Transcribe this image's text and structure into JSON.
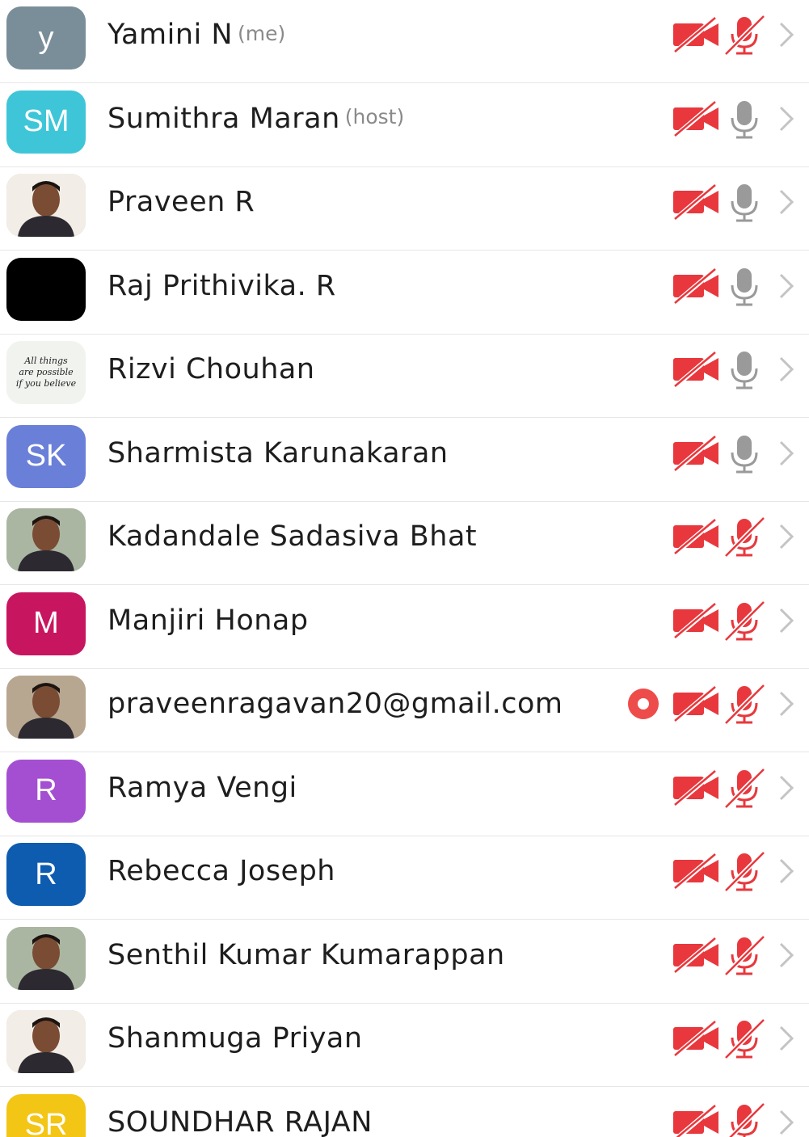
{
  "participants": [
    {
      "name": "Yamini N",
      "tag": "(me)",
      "avatar_type": "initials",
      "initials": "y",
      "avatar_color": "#7a8e9a",
      "video": "off",
      "audio": "muted",
      "recording": false
    },
    {
      "name": "Sumithra Maran",
      "tag": "(host)",
      "avatar_type": "initials",
      "initials": "SM",
      "avatar_color": "#3ec6d8",
      "video": "off",
      "audio": "unmuted",
      "recording": false
    },
    {
      "name": "Praveen R",
      "tag": "",
      "avatar_type": "photo",
      "photo_icon": "person-photo",
      "video": "off",
      "audio": "unmuted",
      "recording": false
    },
    {
      "name": "Raj Prithivika. R",
      "tag": "",
      "avatar_type": "black",
      "avatar_color": "#000000",
      "video": "off",
      "audio": "unmuted",
      "recording": false
    },
    {
      "name": "Rizvi Chouhan",
      "tag": "",
      "avatar_type": "text-photo",
      "photo_text": [
        "All things",
        "are possible",
        "if you believe"
      ],
      "video": "off",
      "audio": "unmuted",
      "recording": false
    },
    {
      "name": "Sharmista Karunakaran",
      "tag": "",
      "avatar_type": "initials",
      "initials": "SK",
      "avatar_color": "#6a7fd8",
      "video": "off",
      "audio": "unmuted",
      "recording": false
    },
    {
      "name": "Kadandale Sadasiva Bhat",
      "tag": "",
      "avatar_type": "photo",
      "photo_icon": "person-photo",
      "video": "off",
      "audio": "muted",
      "recording": false
    },
    {
      "name": "Manjiri Honap",
      "tag": "",
      "avatar_type": "initials",
      "initials": "M",
      "avatar_color": "#c8155f",
      "video": "off",
      "audio": "muted",
      "recording": false
    },
    {
      "name": "praveenragavan20@gmail.com",
      "tag": "",
      "avatar_type": "photo",
      "photo_icon": "person-photo",
      "video": "off",
      "audio": "muted",
      "recording": true
    },
    {
      "name": "Ramya Vengi",
      "tag": "",
      "avatar_type": "initials",
      "initials": "R",
      "avatar_color": "#a44fd1",
      "video": "off",
      "audio": "muted",
      "recording": false
    },
    {
      "name": "Rebecca Joseph",
      "tag": "",
      "avatar_type": "initials",
      "initials": "R",
      "avatar_color": "#0e5cb0",
      "video": "off",
      "audio": "muted",
      "recording": false
    },
    {
      "name": "Senthil Kumar Kumarappan",
      "tag": "",
      "avatar_type": "photo",
      "photo_icon": "person-photo",
      "video": "off",
      "audio": "muted",
      "recording": false
    },
    {
      "name": "Shanmuga Priyan",
      "tag": "",
      "avatar_type": "photo",
      "photo_icon": "person-photo",
      "video": "off",
      "audio": "muted",
      "recording": false
    },
    {
      "name": "SOUNDHAR RAJAN",
      "tag": "",
      "avatar_type": "initials",
      "initials": "SR",
      "avatar_color": "#f3c515",
      "video": "off",
      "audio": "muted",
      "recording": false
    }
  ],
  "colors": {
    "muted_red": "#e8383d",
    "mic_gray": "#9a9a9a",
    "chevron": "#c4c4c4",
    "record_red": "#ee4b4b"
  },
  "icons": {
    "video": "video-off-icon",
    "audio_muted": "mic-muted-icon",
    "audio_on": "mic-icon",
    "more": "chevron-right-icon",
    "recording": "recording-icon"
  }
}
